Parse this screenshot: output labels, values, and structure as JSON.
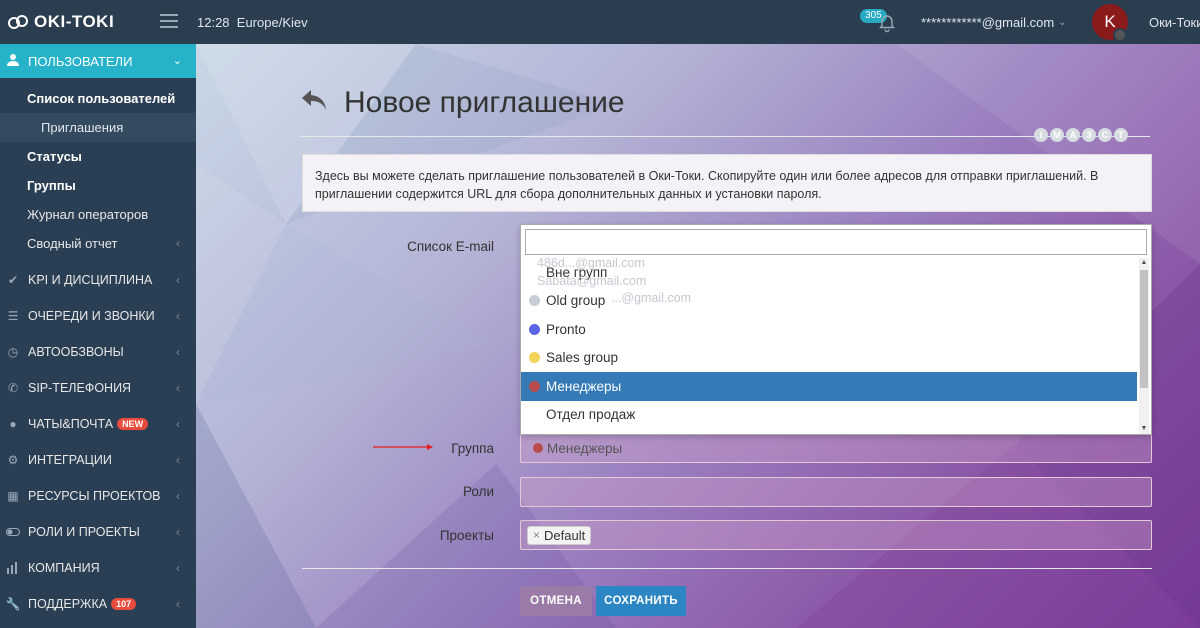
{
  "topbar": {
    "logo_text": "OKI-TOKI",
    "time": "12:28",
    "timezone": "Europe/Kiev",
    "notifications_count": "305",
    "account_email": "************@gmail.com",
    "avatar_letter": "K",
    "company_name": "Оки-Токи"
  },
  "sidebar": {
    "active_section": "ПОЛЬЗОВАТЕЛИ",
    "submenu": [
      {
        "label": "Список пользователей"
      },
      {
        "label": "Приглашения"
      },
      {
        "label": "Статусы"
      },
      {
        "label": "Группы"
      },
      {
        "label": "Журнал операторов"
      },
      {
        "label": "Сводный отчет"
      }
    ],
    "items": [
      {
        "label": "KPI И ДИСЦИПЛИНА",
        "icon": "check-icon"
      },
      {
        "label": "ОЧЕРЕДИ И ЗВОНКИ",
        "icon": "list-icon"
      },
      {
        "label": "АВТООБЗВОНЫ",
        "icon": "clock-icon"
      },
      {
        "label": "SIP-ТЕЛЕФОНИЯ",
        "icon": "phone-icon"
      },
      {
        "label": "ЧАТЫ&ПОЧТА",
        "icon": "chat-icon",
        "badge": "NEW"
      },
      {
        "label": "ИНТЕГРАЦИИ",
        "icon": "gears-icon"
      },
      {
        "label": "РЕСУРСЫ ПРОЕКТОВ",
        "icon": "grid-icon"
      },
      {
        "label": "РОЛИ И ПРОЕКТЫ",
        "icon": "toggle-icon"
      },
      {
        "label": "КОМПАНИЯ",
        "icon": "bar-chart-icon"
      },
      {
        "label": "ПОДДЕРЖКА",
        "icon": "wrench-icon",
        "badge": "107"
      }
    ]
  },
  "page": {
    "title": "Новое приглашение",
    "steps": [
      "I",
      "M",
      "A",
      "3",
      "C",
      "T"
    ],
    "info": "Здесь вы можете сделать приглашение пользователей в Оки-Токи. Скопируйте один или более адресов для отправки приглашений. В приглашении содержится URL для сбора дополнительных данных и установки пароля."
  },
  "form": {
    "email_label": "Список E-mail",
    "group_label": "Группа",
    "roles_label": "Роли",
    "projects_label": "Проекты",
    "group_value": "Менеджеры",
    "projects_tag": "Default",
    "email_ghost": [
      "486d...@gmail.com",
      "Sabata@gmail.com",
      "...@gmail.com"
    ]
  },
  "dropdown": {
    "search_value": "",
    "options": [
      {
        "label": "Вне групп",
        "color": "#ffffff"
      },
      {
        "label": "Old group",
        "color": "#c8ccd4"
      },
      {
        "label": "Pronto",
        "color": "#5b63e6"
      },
      {
        "label": "Sales group",
        "color": "#f2d45a"
      },
      {
        "label": "Менеджеры",
        "color": "#b84b4b",
        "selected": true
      },
      {
        "label": "Отдел продаж",
        "color": "#ffffff"
      }
    ]
  },
  "buttons": {
    "cancel": "ОТМЕНА",
    "save": "СОХРАНИТЬ"
  }
}
